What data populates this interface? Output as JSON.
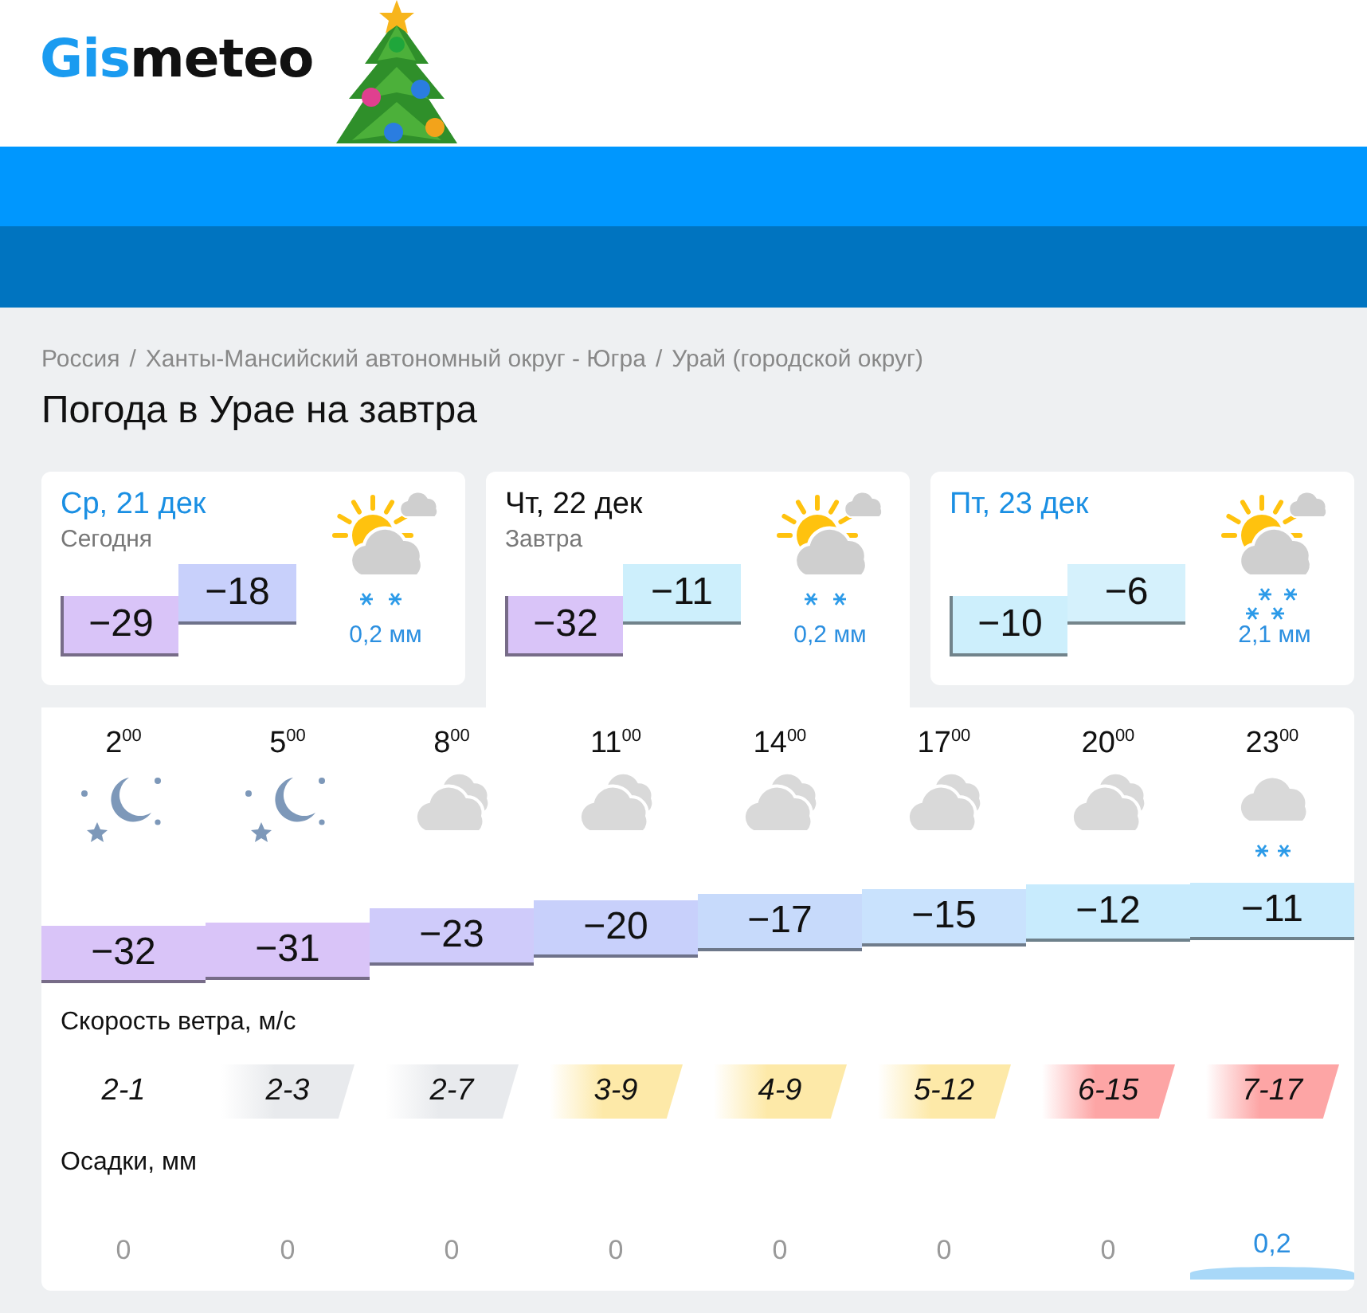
{
  "logo": {
    "accent": "Gis",
    "rest": "meteo"
  },
  "breadcrumb_separator": "/",
  "breadcrumbs": [
    "Россия",
    "Ханты-Мансийский автономный округ - Югра",
    "Урай (городской округ)"
  ],
  "title": "Погода в Урае на завтра",
  "days": [
    {
      "date": "Ср, 21 дек",
      "note": "Сегодня",
      "selected": false,
      "kind": "light-snow",
      "min": {
        "value": "−29",
        "color": "#d9c4f8"
      },
      "max": {
        "value": "−18",
        "color": "#c8d0fb"
      },
      "precip": "0,2 мм"
    },
    {
      "date": "Чт, 22 дек",
      "note": "Завтра",
      "selected": true,
      "kind": "light-snow",
      "min": {
        "value": "−32",
        "color": "#d9c4f8"
      },
      "max": {
        "value": "−11",
        "color": "#cdeffc"
      },
      "precip": "0,2 мм"
    },
    {
      "date": "Пт, 23 дек",
      "selected": false,
      "kind": "snow",
      "min": {
        "value": "−10",
        "color": "#cdeffc"
      },
      "max": {
        "value": "−6",
        "color": "#d5f1fc"
      },
      "precip": "2,1 мм"
    }
  ],
  "hours": [
    {
      "time": "2$^{00}$",
      "kind": "night",
      "temp": "−32",
      "color": "#d9c4f8"
    },
    {
      "time": "5$^{00}$",
      "kind": "night",
      "temp": "−31",
      "color": "#d9c4f8"
    },
    {
      "time": "8$^{00}$",
      "kind": "cloudy",
      "temp": "−23",
      "color": "#cfcbfa"
    },
    {
      "time": "11$^{00}$",
      "kind": "cloudy",
      "temp": "−20",
      "color": "#c8d0fb"
    },
    {
      "time": "14$^{00}$",
      "kind": "cloudy",
      "temp": "−17",
      "color": "#c7dafb"
    },
    {
      "time": "17$^{00}$",
      "kind": "cloudy",
      "temp": "−15",
      "color": "#c9e2fd"
    },
    {
      "time": "20$^{00}$",
      "kind": "cloudy",
      "temp": "−12",
      "color": "#c8ebfd"
    },
    {
      "time": "23$^{00}$",
      "kind": "snow",
      "temp": "−11",
      "color": "#c8ebfd"
    }
  ],
  "wind": {
    "label": "Скорость ветра, м/с",
    "values": [
      {
        "value": "2-1",
        "color": "#ffffff"
      },
      {
        "value": "2-3",
        "color": "#e8eaed"
      },
      {
        "value": "2-7",
        "color": "#e8eaed"
      },
      {
        "value": "3-9",
        "color": "#fde9a8"
      },
      {
        "value": "4-9",
        "color": "#fde9a8"
      },
      {
        "value": "5-12",
        "color": "#fde9a8"
      },
      {
        "value": "6-15",
        "color": "#fda5a5"
      },
      {
        "value": "7-17",
        "color": "#fda5a5"
      }
    ]
  },
  "precipitation": {
    "label": "Осадки, мм",
    "values": [
      {
        "value": "0",
        "kind": "dry"
      },
      {
        "value": "0",
        "kind": "dry"
      },
      {
        "value": "0",
        "kind": "dry"
      },
      {
        "value": "0",
        "kind": "dry"
      },
      {
        "value": "0",
        "kind": "dry"
      },
      {
        "value": "0",
        "kind": "dry"
      },
      {
        "value": "0",
        "kind": "dry"
      },
      {
        "value": "0,2",
        "kind": "wet"
      }
    ]
  }
}
